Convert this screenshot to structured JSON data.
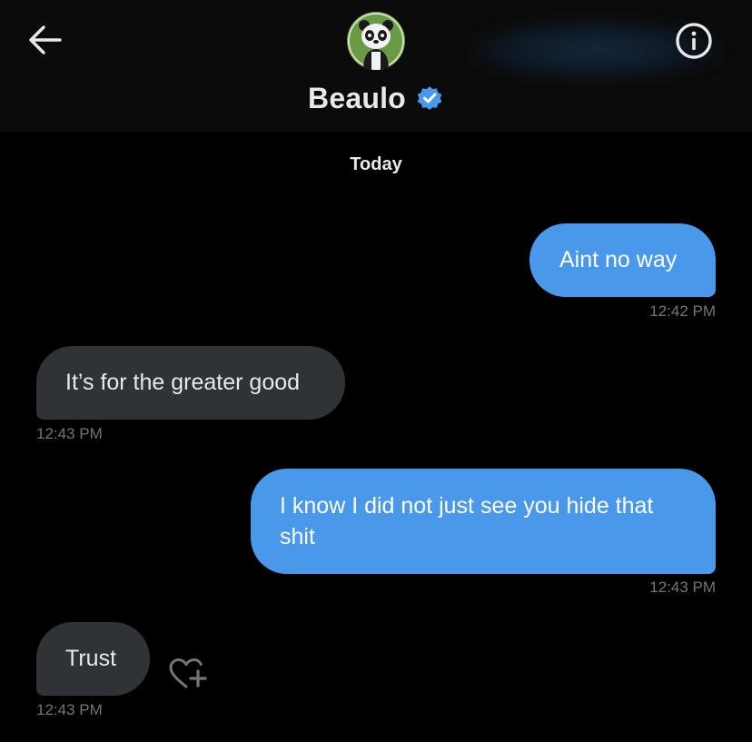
{
  "header": {
    "contact_name": "Beaulo",
    "verified": true,
    "icons": {
      "back": "arrow-left-icon",
      "info": "info-circle-icon",
      "verified": "verified-badge-icon",
      "avatar": "panda-avatar"
    }
  },
  "colors": {
    "background": "#000000",
    "header_bg": "#0b0b0b",
    "outgoing_bubble": "#4a98e9",
    "incoming_bubble": "#2f3336",
    "timestamp": "#71767b",
    "verified_blue": "#4a98e9"
  },
  "conversation": {
    "date_label": "Today",
    "messages": [
      {
        "direction": "outgoing",
        "text": "Aint no way",
        "time": "12:42 PM"
      },
      {
        "direction": "incoming",
        "text": "It’s for the greater good",
        "time": "12:43 PM"
      },
      {
        "direction": "outgoing",
        "text_line1": "I know I did not just see you hide that",
        "text_line2": "shit",
        "time": "12:43 PM"
      },
      {
        "direction": "incoming",
        "text": "Trust",
        "time": "12:43 PM"
      }
    ],
    "reaction_icon": "heart-add-icon"
  }
}
